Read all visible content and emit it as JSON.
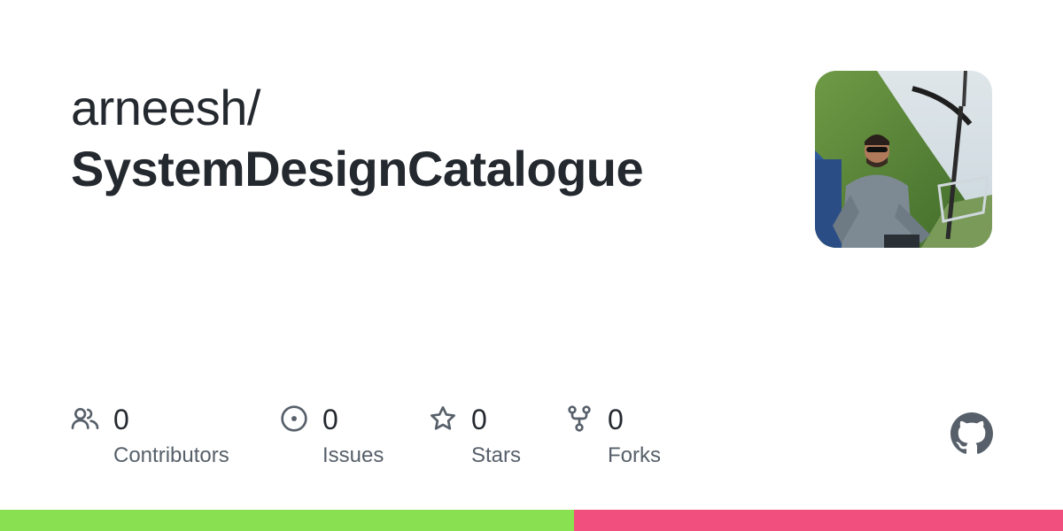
{
  "repo": {
    "owner": "arneesh/",
    "name": "SystemDesignCatalogue"
  },
  "avatar": {
    "alt": "owner avatar photo"
  },
  "stats": [
    {
      "icon": "people-icon",
      "count": "0",
      "label": "Contributors"
    },
    {
      "icon": "issue-icon",
      "count": "0",
      "label": "Issues"
    },
    {
      "icon": "star-icon",
      "count": "0",
      "label": "Stars"
    },
    {
      "icon": "fork-icon",
      "count": "0",
      "label": "Forks"
    }
  ],
  "language_bar": [
    {
      "color": "#89e051",
      "fraction": 0.54
    },
    {
      "color": "#f1507e",
      "fraction": 0.46
    }
  ],
  "colors": {
    "icon": "#57606a",
    "text": "#24292f",
    "muted": "#57606a"
  }
}
